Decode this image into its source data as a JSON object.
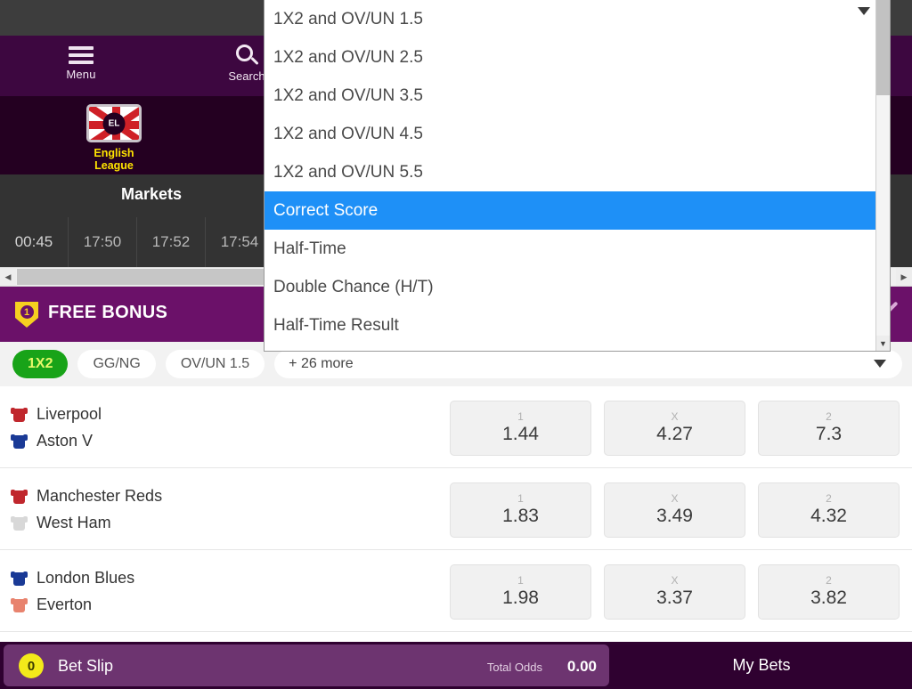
{
  "header": {
    "menu_label": "Menu",
    "search_label": "Search",
    "menu_icon": "hamburger-icon",
    "search_icon": "search-icon"
  },
  "league": {
    "name": "English League",
    "badge_text": "EL",
    "flag_icon": "england-flag-icon"
  },
  "markets": {
    "title": "Markets",
    "time_tabs": [
      "00:45",
      "17:50",
      "17:52",
      "17:54"
    ]
  },
  "bonus": {
    "label": "FREE BONUS",
    "badge_count": "1",
    "shield_icon": "shield-icon",
    "check_icon": "check-icon"
  },
  "chips": [
    {
      "label": "1X2",
      "active": true
    },
    {
      "label": "GG/NG",
      "active": false
    },
    {
      "label": "OV/UN 1.5",
      "active": false
    }
  ],
  "more_chip": {
    "label": "+ 26 more",
    "caret_icon": "chevron-down-icon"
  },
  "dropdown": {
    "open": true,
    "selected": "Correct Score",
    "items": [
      "1X2 and OV/UN 1.5",
      "1X2 and OV/UN 2.5",
      "1X2 and OV/UN 3.5",
      "1X2 and OV/UN 4.5",
      "1X2 and OV/UN 5.5",
      "Correct Score",
      "Half-Time",
      "Double Chance (H/T)",
      "Half-Time Result"
    ]
  },
  "matches": [
    {
      "home": "Liverpool",
      "away": "Aston V",
      "home_color": "#c0272d",
      "away_color": "#1a3a96",
      "odds": [
        {
          "key": "1",
          "value": "1.44"
        },
        {
          "key": "X",
          "value": "4.27"
        },
        {
          "key": "2",
          "value": "7.3"
        }
      ]
    },
    {
      "home": "Manchester Reds",
      "away": "West Ham",
      "home_color": "#c0272d",
      "away_color": "#d8d8d8",
      "odds": [
        {
          "key": "1",
          "value": "1.83"
        },
        {
          "key": "X",
          "value": "3.49"
        },
        {
          "key": "2",
          "value": "4.32"
        }
      ]
    },
    {
      "home": "London Blues",
      "away": "Everton",
      "home_color": "#1a3a96",
      "away_color": "#e8836e",
      "odds": [
        {
          "key": "1",
          "value": "1.98"
        },
        {
          "key": "X",
          "value": "3.37"
        },
        {
          "key": "2",
          "value": "3.82"
        }
      ]
    }
  ],
  "bottom": {
    "betslip_label": "Bet Slip",
    "betslip_count": "0",
    "total_odds_label": "Total Odds",
    "total_odds_value": "0.00",
    "mybets_label": "My Bets"
  },
  "scroll": {
    "left_arrow": "◀",
    "right_arrow": "▶",
    "down_arrow": "▼"
  },
  "colors": {
    "brand_purple": "#3d0740",
    "deep_purple": "#240021",
    "bonus_purple": "#6b1169",
    "accent_green": "#18a318",
    "accent_yellow": "#ffe400",
    "selected_blue": "#1e90f7"
  }
}
